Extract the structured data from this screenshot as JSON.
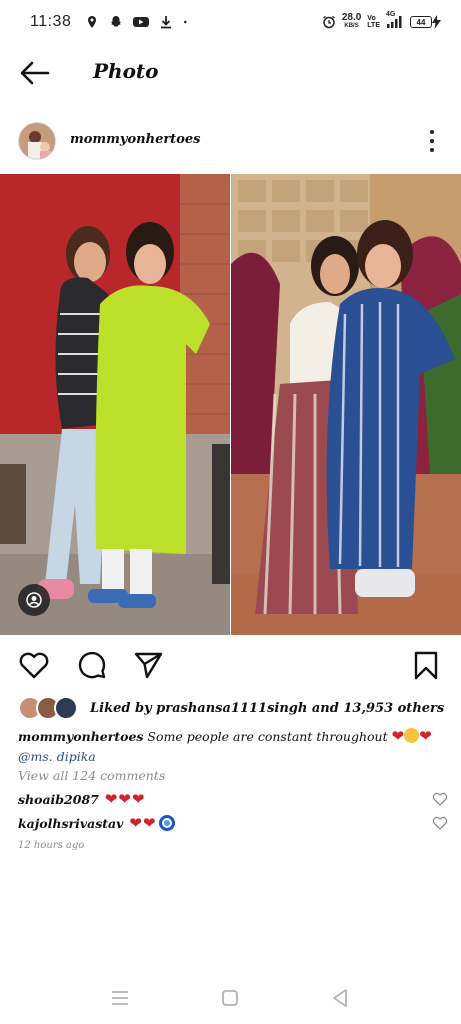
{
  "status_bar": {
    "time": "11:38",
    "net_speed_value": "28.0",
    "net_speed_unit": "KB/S",
    "volte_top": "Vo",
    "volte_bottom": "LTE",
    "signal_label": "4G",
    "battery": "44"
  },
  "header": {
    "title": "Photo"
  },
  "post": {
    "username": "mommyonhertoes",
    "likes_prefix": "Liked by ",
    "likes_user": "prashansa1111singh",
    "likes_suffix": " and 13,953 others",
    "caption_user": "mommyonhertoes",
    "caption_text": "Some people are constant throughout",
    "caption_mention": "@ms. dipika",
    "view_comments": "View all 124 comments",
    "timestamp": "12 hours ago"
  },
  "comments": [
    {
      "user": "shoaib2087",
      "emoji": "❤❤❤"
    },
    {
      "user": "kajolhsrivastav",
      "emoji": "❤❤"
    }
  ],
  "icons": {
    "heart": "heart-icon",
    "comment": "comment-icon",
    "share": "send-icon",
    "save": "bookmark-icon"
  },
  "colors": {
    "mention": "#2d4d8a",
    "muted": "#8e8e8e",
    "heart_emoji": "#d2222d"
  }
}
